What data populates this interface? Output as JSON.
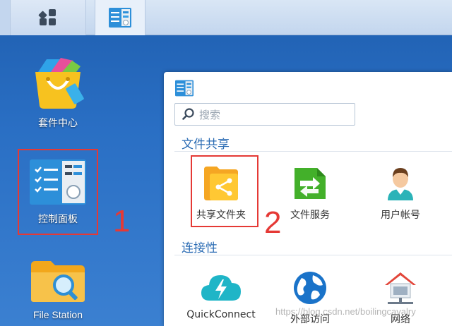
{
  "taskbar": {
    "main_menu_icon": "grid-icon",
    "active_app_icon": "control-panel-icon"
  },
  "desktop": {
    "items": [
      {
        "label": "套件中心",
        "icon": "package-center-icon"
      },
      {
        "label": "控制面板",
        "icon": "control-panel-icon"
      },
      {
        "label": "File Station",
        "icon": "file-station-icon"
      }
    ]
  },
  "annotations": {
    "step1": "1",
    "step2": "2",
    "color": "#e53935"
  },
  "panel": {
    "search_placeholder": "搜索",
    "sections": [
      {
        "title": "文件共享",
        "items": [
          {
            "label": "共享文件夹",
            "icon": "shared-folder-icon"
          },
          {
            "label": "文件服务",
            "icon": "file-services-icon"
          },
          {
            "label": "用户帐号",
            "icon": "user-icon"
          }
        ]
      },
      {
        "title": "连接性",
        "items": [
          {
            "label": "QuickConnect",
            "icon": "quickconnect-icon"
          },
          {
            "label": "外部访问",
            "icon": "external-access-icon"
          },
          {
            "label": "网络",
            "icon": "network-icon"
          }
        ]
      }
    ]
  },
  "watermark": "https://blog.csdn.net/boilingcavalry"
}
